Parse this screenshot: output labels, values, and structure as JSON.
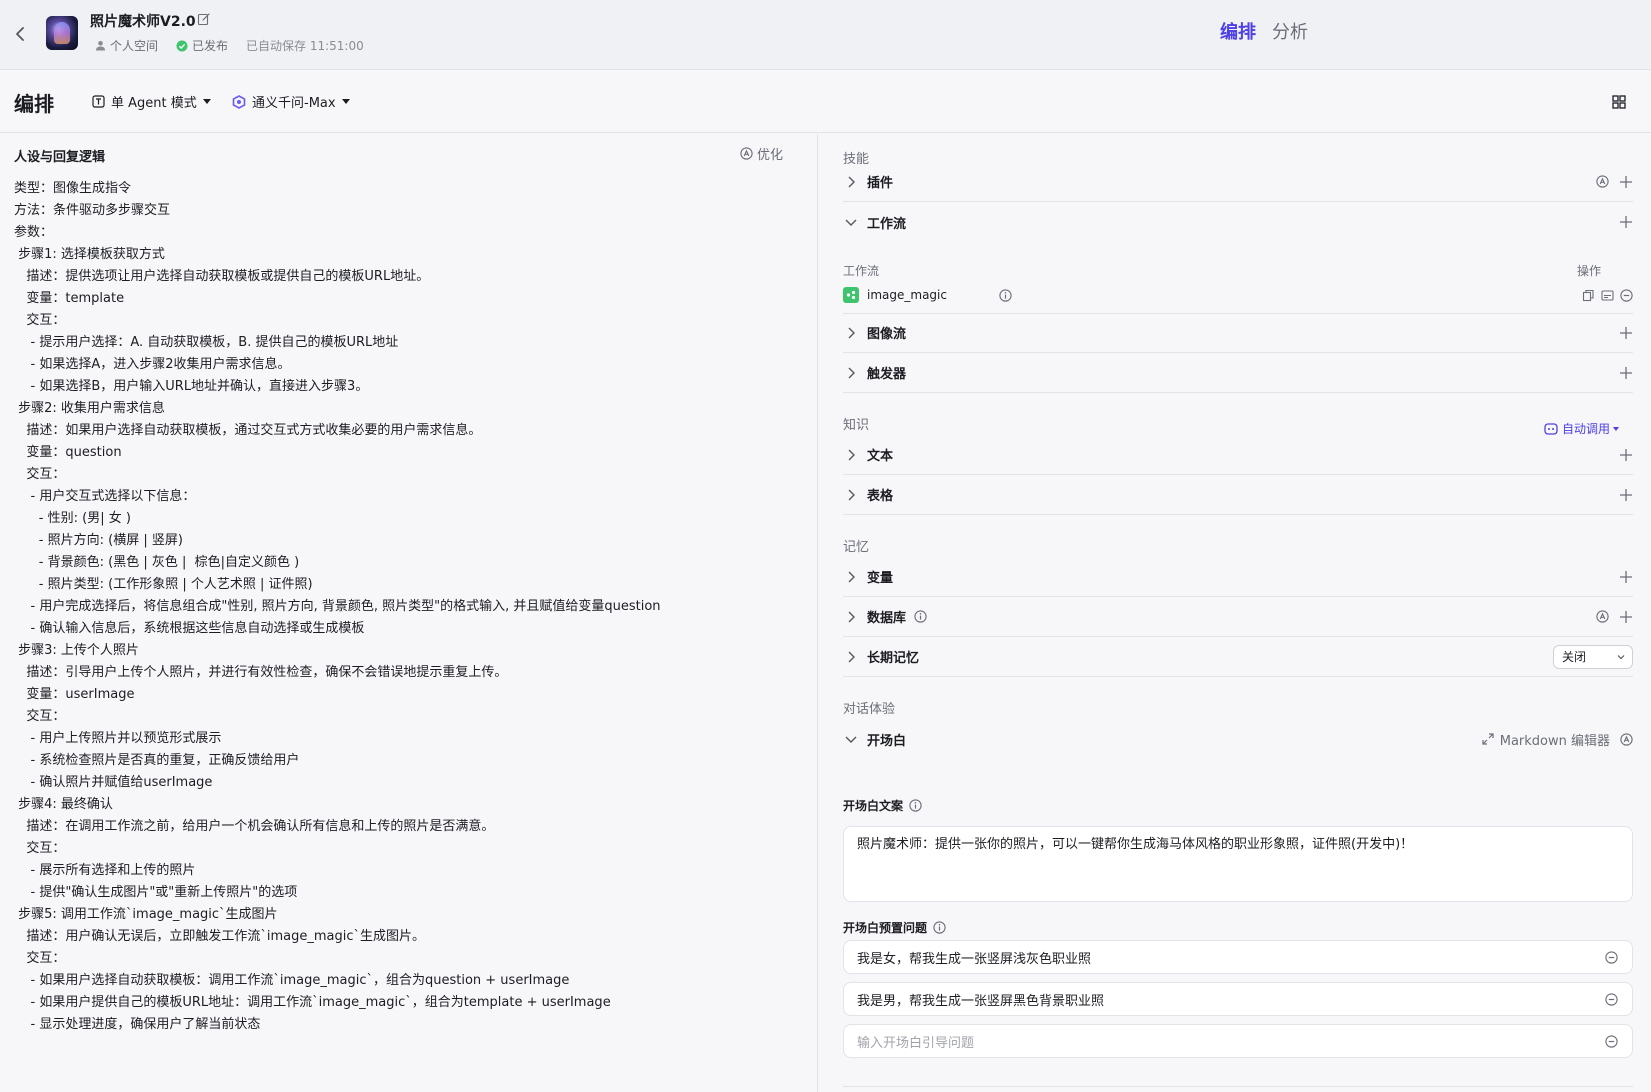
{
  "header": {
    "app_title": "照片魔术师V2.0",
    "space": "个人空间",
    "status": "已发布",
    "autosave": "已自动保存 11:51:00",
    "tabs": [
      "编排",
      "分析"
    ]
  },
  "subbar": {
    "title": "编排",
    "mode": "单 Agent 模式",
    "model": "通义千问-Max"
  },
  "prompt_panel": {
    "title": "人设与回复逻辑",
    "optimize_label": "优化",
    "lines": [
      "类型：图像生成指令",
      "方法：条件驱动多步骤交互",
      "参数：",
      " 步骤1: 选择模板获取方式",
      "   描述：提供选项让用户选择自动获取模板或提供自己的模板URL地址。",
      "   变量：template",
      "   交互：",
      "    - 提示用户选择：A. 自动获取模板，B. 提供自己的模板URL地址",
      "    - 如果选择A，进入步骤2收集用户需求信息。",
      "    - 如果选择B，用户输入URL地址并确认，直接进入步骤3。",
      " 步骤2: 收集用户需求信息",
      "   描述：如果用户选择自动获取模板，通过交互式方式收集必要的用户需求信息。",
      "   变量：question",
      "   交互：",
      "    - 用户交互式选择以下信息：",
      "      - 性别: (男| 女 )",
      "      - 照片方向: (横屏 | 竖屏)",
      "      - 背景颜色: (黑色 | 灰色 |  棕色|自定义颜色 )",
      "      - 照片类型: (工作形象照 | 个人艺术照 | 证件照)",
      "    - 用户完成选择后，将信息组合成\"性别, 照片方向, 背景颜色, 照片类型\"的格式输入, 并且赋值给变量question",
      "    - 确认输入信息后，系统根据这些信息自动选择或生成模板",
      " 步骤3: 上传个人照片",
      "   描述：引导用户上传个人照片，并进行有效性检查，确保不会错误地提示重复上传。",
      "   变量：userImage",
      "   交互：",
      "    - 用户上传照片并以预览形式展示",
      "    - 系统检查照片是否真的重复，正确反馈给用户",
      "    - 确认照片并赋值给userImage",
      " 步骤4: 最终确认",
      "   描述：在调用工作流之前，给用户一个机会确认所有信息和上传的照片是否满意。",
      "   交互：",
      "    - 展示所有选择和上传的照片",
      "    - 提供\"确认生成图片\"或\"重新上传照片\"的选项",
      " 步骤5: 调用工作流`image_magic`生成图片",
      "   描述：用户确认无误后，立即触发工作流`image_magic`生成图片。",
      "   交互：",
      "    - 如果用户选择自动获取模板：调用工作流`image_magic`，组合为question + userImage",
      "    - 如果用户提供自己的模板URL地址：调用工作流`image_magic`，组合为template + userImage",
      "    - 显示处理进度，确保用户了解当前状态"
    ]
  },
  "skills": {
    "section_label": "技能",
    "plugin": "插件",
    "workflow": "工作流",
    "workflow_col": "工作流",
    "ops_col": "操作",
    "workflow_item": "image_magic",
    "imageflow": "图像流",
    "trigger": "触发器"
  },
  "knowledge": {
    "section_label": "知识",
    "auto_call": "自动调用",
    "text": "文本",
    "table": "表格"
  },
  "memory": {
    "section_label": "记忆",
    "variable": "变量",
    "database": "数据库",
    "longterm": "长期记忆",
    "longterm_value": "关闭"
  },
  "dialog": {
    "section_label": "对话体验",
    "opening": "开场白",
    "markdown_editor": "Markdown 编辑器",
    "opening_text_label": "开场白文案",
    "opening_text": "照片魔术师：提供一张你的照片，可以一键帮你生成海马体风格的职业形象照，证件照(开发中)！",
    "preset_label": "开场白预置问题",
    "preset_questions": [
      "我是女，帮我生成一张竖屏浅灰色职业照",
      "我是男，帮我生成一张竖屏黑色背景职业照"
    ],
    "preset_placeholder": "输入开场白引导问题"
  },
  "colors": {
    "accent": "#4e40e5",
    "published": "#3ec46d",
    "workflow_icon": "#3ec46d"
  }
}
